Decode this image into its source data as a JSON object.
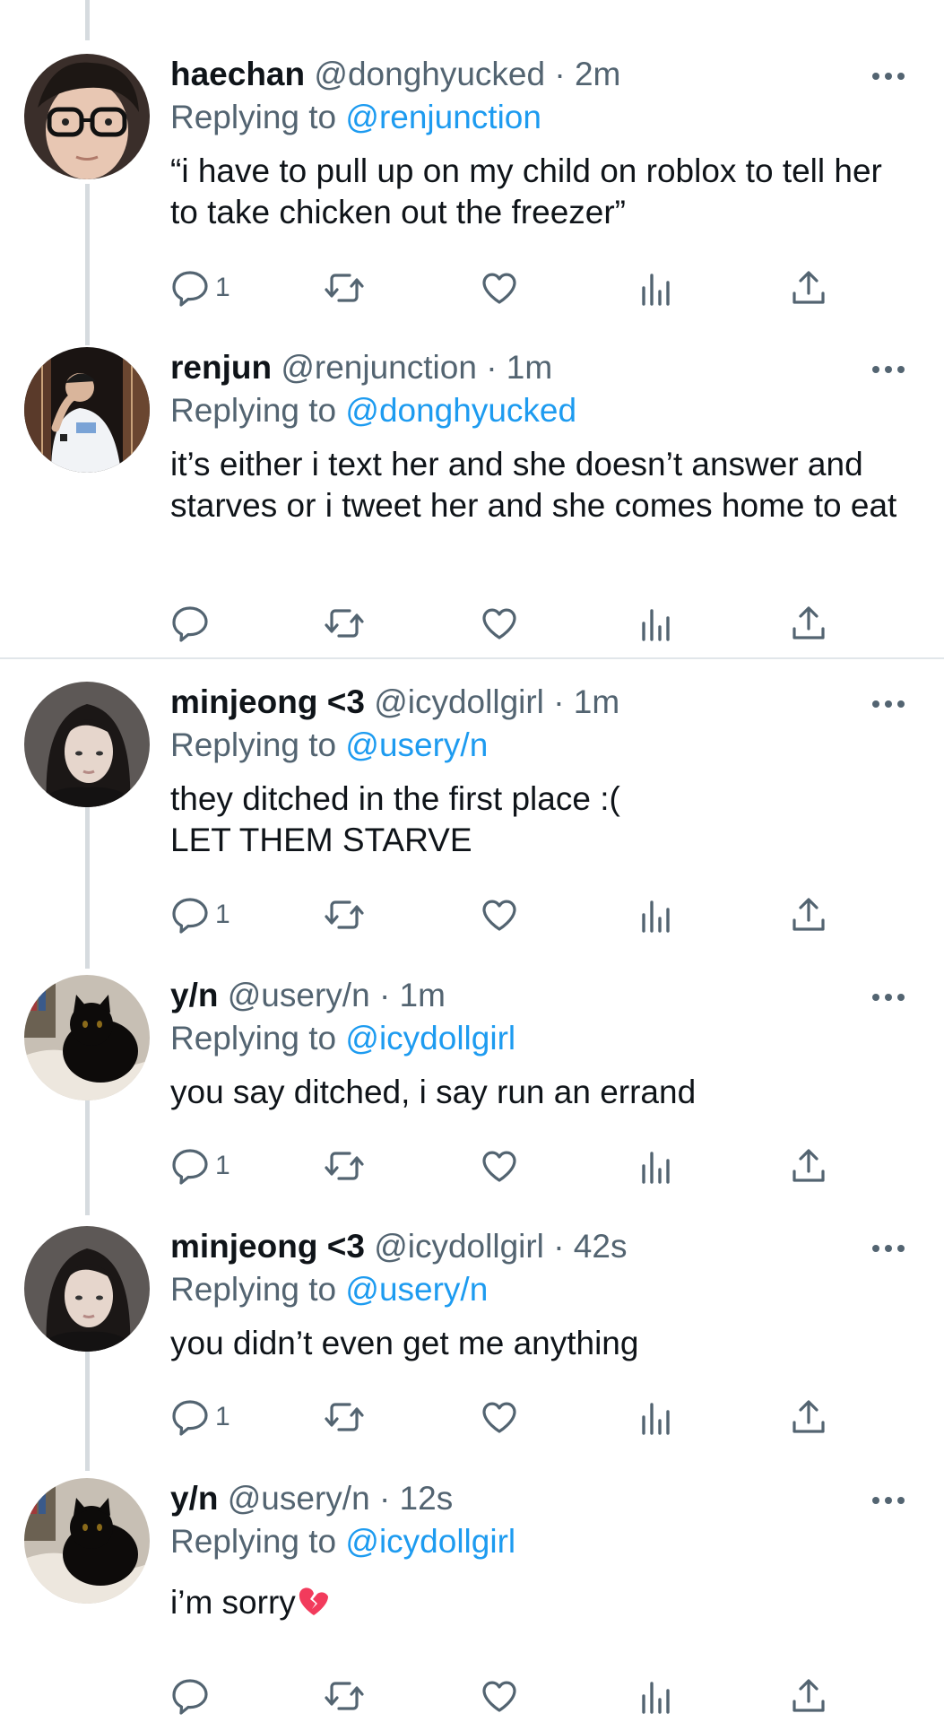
{
  "tweets": [
    {
      "name": "haechan",
      "handle": "@donghyucked",
      "time": "· 2m",
      "reply_prefix": "Replying to",
      "reply_to": "@renjunction",
      "text": "“i have to pull up on my child on roblox to tell her to take chicken out the freezer”",
      "reply_count": "1",
      "avatar": "glasses-boy-avatar"
    },
    {
      "name": "renjun",
      "handle": "@renjunction",
      "time": "· 1m",
      "reply_prefix": "Replying to",
      "reply_to": "@donghyucked",
      "text": "it’s either i text her and she doesn’t answer and starves or i tweet her and she comes home to eat",
      "reply_count": "",
      "avatar": "boy-white-shirt-avatar"
    },
    {
      "name": "minjeong <3",
      "handle": "@icydollgirl",
      "time": "· 1m",
      "reply_prefix": "Replying to",
      "reply_to": "@usery/n",
      "text": "they ditched in the first place :(\nLET THEM STARVE",
      "reply_count": "1",
      "avatar": "girl-dark-hair-avatar"
    },
    {
      "name": "y/n",
      "handle": "@usery/n",
      "time": "· 1m",
      "reply_prefix": "Replying to",
      "reply_to": "@icydollgirl",
      "text": "you say ditched, i say run an errand",
      "reply_count": "1",
      "avatar": "black-cat-avatar"
    },
    {
      "name": "minjeong <3",
      "handle": "@icydollgirl",
      "time": "· 42s",
      "reply_prefix": "Replying to",
      "reply_to": "@usery/n",
      "text": "you didn’t even get me anything",
      "reply_count": "1",
      "avatar": "girl-dark-hair-avatar"
    },
    {
      "name": "y/n",
      "handle": "@usery/n",
      "time": "· 12s",
      "reply_prefix": "Replying to",
      "reply_to": "@icydollgirl",
      "text": "i’m sorry",
      "reply_count": "",
      "avatar": "black-cat-avatar",
      "emoji": "broken-heart-icon"
    }
  ],
  "colors": {
    "text": "#0f1419",
    "secondary": "#536471",
    "link": "#1d9bf0",
    "thread_line": "#d6dbdf",
    "divider": "#e1e6ea"
  }
}
